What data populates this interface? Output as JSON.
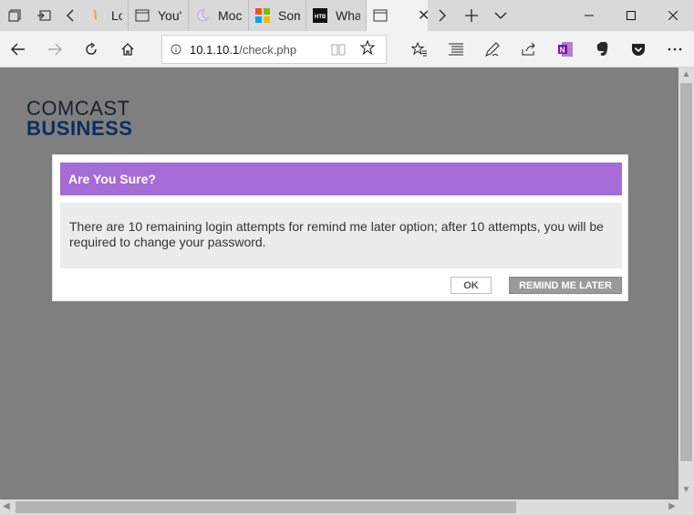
{
  "tabs": [
    {
      "title": "Log",
      "icon": "loading-icon"
    },
    {
      "title": "You'",
      "icon": "page-icon"
    },
    {
      "title": "Moc",
      "icon": "moon-icon"
    },
    {
      "title": "Som",
      "icon": "microsoft-icon"
    },
    {
      "title": "Wha",
      "icon": "htb-icon"
    },
    {
      "title": "",
      "icon": "page-icon"
    }
  ],
  "address": {
    "host": "10.1.10.1",
    "path": "/check.php"
  },
  "logo": {
    "line1": "COMCAST",
    "line2": "BUSINESS"
  },
  "dialog": {
    "title": "Are You Sure?",
    "message": "There are 10 remaining login attempts for remind me later option; after 10 attempts, you will be required to change your password.",
    "ok_label": "OK",
    "later_label": "REMIND ME LATER"
  },
  "colors": {
    "dialog_header": "#a66cd6",
    "overlay": "#7f7f7f"
  }
}
